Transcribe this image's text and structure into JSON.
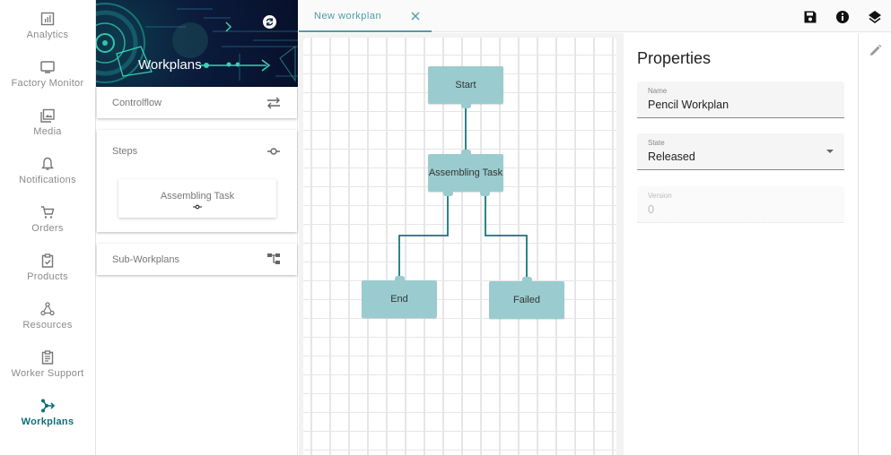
{
  "nav": {
    "items": [
      {
        "label": "Analytics",
        "icon": "analytics-icon"
      },
      {
        "label": "Factory Monitor",
        "icon": "monitor-icon"
      },
      {
        "label": "Media",
        "icon": "media-icon"
      },
      {
        "label": "Notifications",
        "icon": "bell-icon"
      },
      {
        "label": "Orders",
        "icon": "cart-icon"
      },
      {
        "label": "Products",
        "icon": "clipboard-check-icon"
      },
      {
        "label": "Resources",
        "icon": "resources-icon"
      },
      {
        "label": "Worker Support",
        "icon": "clipboard-text-icon"
      },
      {
        "label": "Workplans",
        "icon": "workplans-icon",
        "active": true
      }
    ],
    "active_color": "#0e6f78"
  },
  "library": {
    "banner_title": "Workplans",
    "sections": {
      "controlflow": "Controlflow",
      "steps": "Steps",
      "sub_workplans": "Sub-Workplans"
    },
    "steps": [
      {
        "label": "Assembling Task"
      }
    ]
  },
  "editor": {
    "tabs": [
      {
        "label": "New workplan",
        "active": true
      }
    ],
    "toolbar": [
      "save-icon",
      "info-icon",
      "layers-icon"
    ],
    "nodes": {
      "start": "Start",
      "task": "Assembling Task",
      "end": "End",
      "failed": "Failed"
    },
    "colors": {
      "node": "#9acccf",
      "edge": "#17767c",
      "accent": "#4f9da5"
    }
  },
  "properties": {
    "title": "Properties",
    "name": {
      "label": "Name",
      "value": "Pencil Workplan"
    },
    "state": {
      "label": "State",
      "value": "Released"
    },
    "version": {
      "label": "Version",
      "value": "0"
    }
  }
}
